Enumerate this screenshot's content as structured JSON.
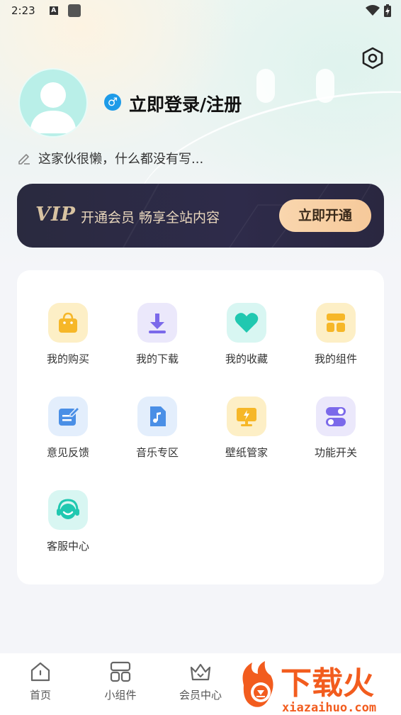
{
  "status_bar": {
    "time": "2:23",
    "a_icon": "A"
  },
  "profile": {
    "gender_symbol": "♂",
    "login_title": "立即登录/注册",
    "bio": "这家伙很懒，什么都没有写..."
  },
  "vip": {
    "logo": "VIP",
    "text": "开通会员  畅享全站内容",
    "button": "立即开通"
  },
  "grid": [
    {
      "label": "我的购买",
      "icon": "shopping-bag-icon",
      "bg": "#fdefc6",
      "color": "#f6b728"
    },
    {
      "label": "我的下载",
      "icon": "download-icon",
      "bg": "#ebe8fb",
      "color": "#7b69ea"
    },
    {
      "label": "我的收藏",
      "icon": "heart-icon",
      "bg": "#d8f6f2",
      "color": "#20c8b0"
    },
    {
      "label": "我的组件",
      "icon": "widgets-icon",
      "bg": "#fdefc6",
      "color": "#f6b728"
    },
    {
      "label": "意见反馈",
      "icon": "feedback-edit-icon",
      "bg": "#e3eefc",
      "color": "#4a8fe6"
    },
    {
      "label": "音乐专区",
      "icon": "music-file-icon",
      "bg": "#e3eefc",
      "color": "#4a8fe6"
    },
    {
      "label": "壁纸管家",
      "icon": "wallpaper-monitor-icon",
      "bg": "#fdefc6",
      "color": "#f6b728"
    },
    {
      "label": "功能开关",
      "icon": "toggle-switch-icon",
      "bg": "#ebe8fb",
      "color": "#7b69ea"
    },
    {
      "label": "客服中心",
      "icon": "headset-smile-icon",
      "bg": "#d8f6f2",
      "color": "#20c8b0"
    }
  ],
  "tabs": [
    {
      "label": "首页",
      "icon": "home-icon"
    },
    {
      "label": "小组件",
      "icon": "widget-grid-icon"
    },
    {
      "label": "会员中心",
      "icon": "crown-icon"
    }
  ],
  "watermark": {
    "brand": "下载火",
    "url": "xiazaihuo.com"
  }
}
